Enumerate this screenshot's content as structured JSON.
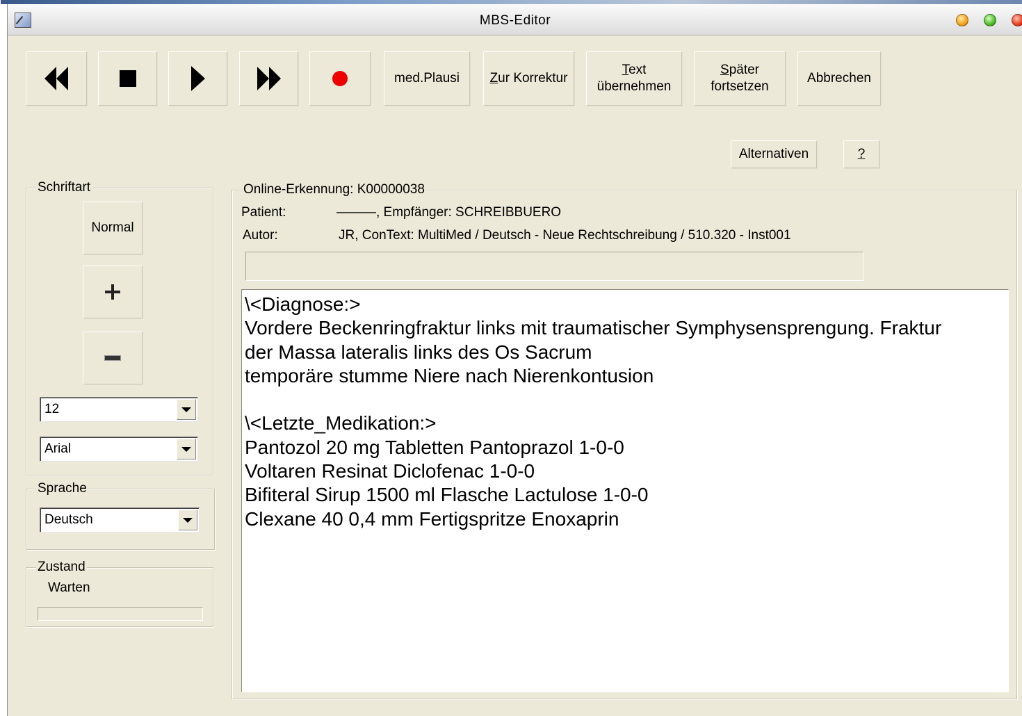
{
  "window": {
    "title": "MBS-Editor"
  },
  "toolbar": {
    "rewind": "rewind",
    "stop": "stop",
    "play": "play",
    "fast_forward": "fast-forward",
    "record": "record",
    "med_plausi": "med.Plausi",
    "zur_korrektur_first": "Z",
    "zur_korrektur_rest": "ur Korrektur",
    "text_uebernehmen_first": "T",
    "text_uebernehmen_rest": "ext",
    "text_uebernehmen_line2": "übernehmen",
    "spaeter_first": "S",
    "spaeter_rest": "päter",
    "spaeter_line2": "fortsetzen",
    "abbrechen": "Abbrechen",
    "alternativen": "Alternativen",
    "help": "?"
  },
  "schriftart": {
    "label": "Schriftart",
    "normal": "Normal",
    "size": "12",
    "font": "Arial"
  },
  "sprache": {
    "label": "Sprache",
    "value": "Deutsch"
  },
  "zustand": {
    "label": "Zustand",
    "status": "Warten",
    "progress": 0
  },
  "erkennung": {
    "label": "Online-Erkennung: K00000038",
    "patient_label": "Patient:",
    "patient_value": "———, Empfänger: SCHREIBBUERO",
    "autor_label": "Autor:",
    "autor_value": "JR, ConText: MultiMed / Deutsch - Neue Rechtschreibung / 510.320 - Inst001",
    "info_field": ""
  },
  "editor": {
    "lines": [
      "\\<Diagnose:>",
      "Vordere Beckenringfraktur links mit traumatischer Symphysensprengung. Fraktur",
      "der Massa lateralis links des Os Sacrum",
      "temporäre stumme Niere nach Nierenkontusion",
      "",
      "\\<Letzte_Medikation:>",
      "Pantozol 20 mg Tabletten Pantoprazol 1-0-0",
      "Voltaren Resinat Diclofenac 1-0-0",
      "Bifiteral Sirup 1500 ml Flasche Lactulose 1-0-0",
      "Clexane 40 0,4 mm Fertigspritze Enoxaprin"
    ]
  }
}
